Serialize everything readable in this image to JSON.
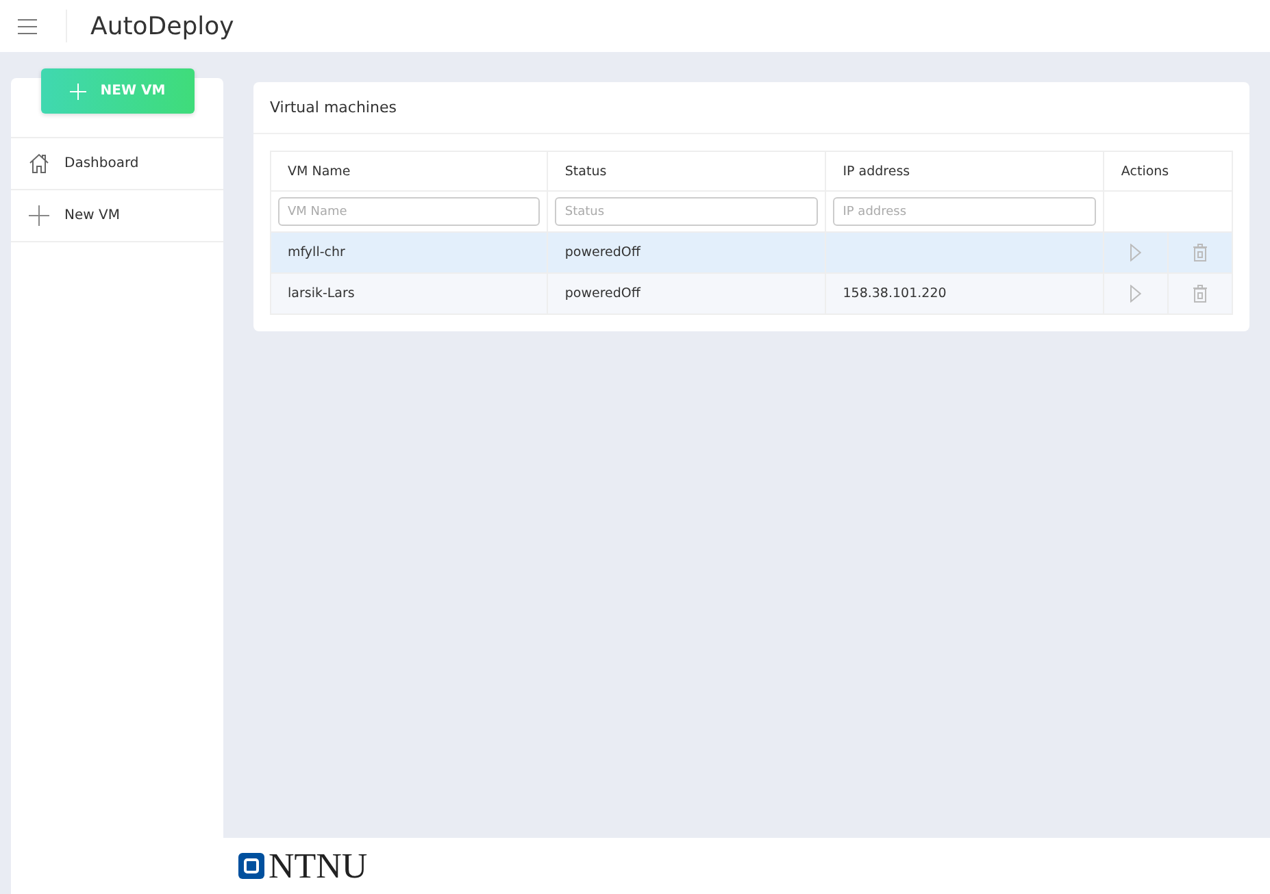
{
  "app": {
    "title": "AutoDeploy"
  },
  "sidebar": {
    "new_button": "NEW VM",
    "items": [
      {
        "kind": "home",
        "label": "Dashboard"
      },
      {
        "kind": "plus",
        "label": "New VM"
      }
    ]
  },
  "card": {
    "title": "Virtual machines",
    "columns": [
      "VM Name",
      "Status",
      "IP address",
      "Actions"
    ],
    "filters": [
      {
        "placeholder": "VM Name"
      },
      {
        "placeholder": "Status"
      },
      {
        "placeholder": "IP address"
      }
    ],
    "rows": [
      {
        "name": "mfyll-chr",
        "status": "poweredOff",
        "ip": "",
        "selected": true
      },
      {
        "name": "larsik-Lars",
        "status": "poweredOff",
        "ip": "158.38.101.220",
        "selected": false
      }
    ]
  },
  "footer": {
    "logo": "NTNU"
  }
}
